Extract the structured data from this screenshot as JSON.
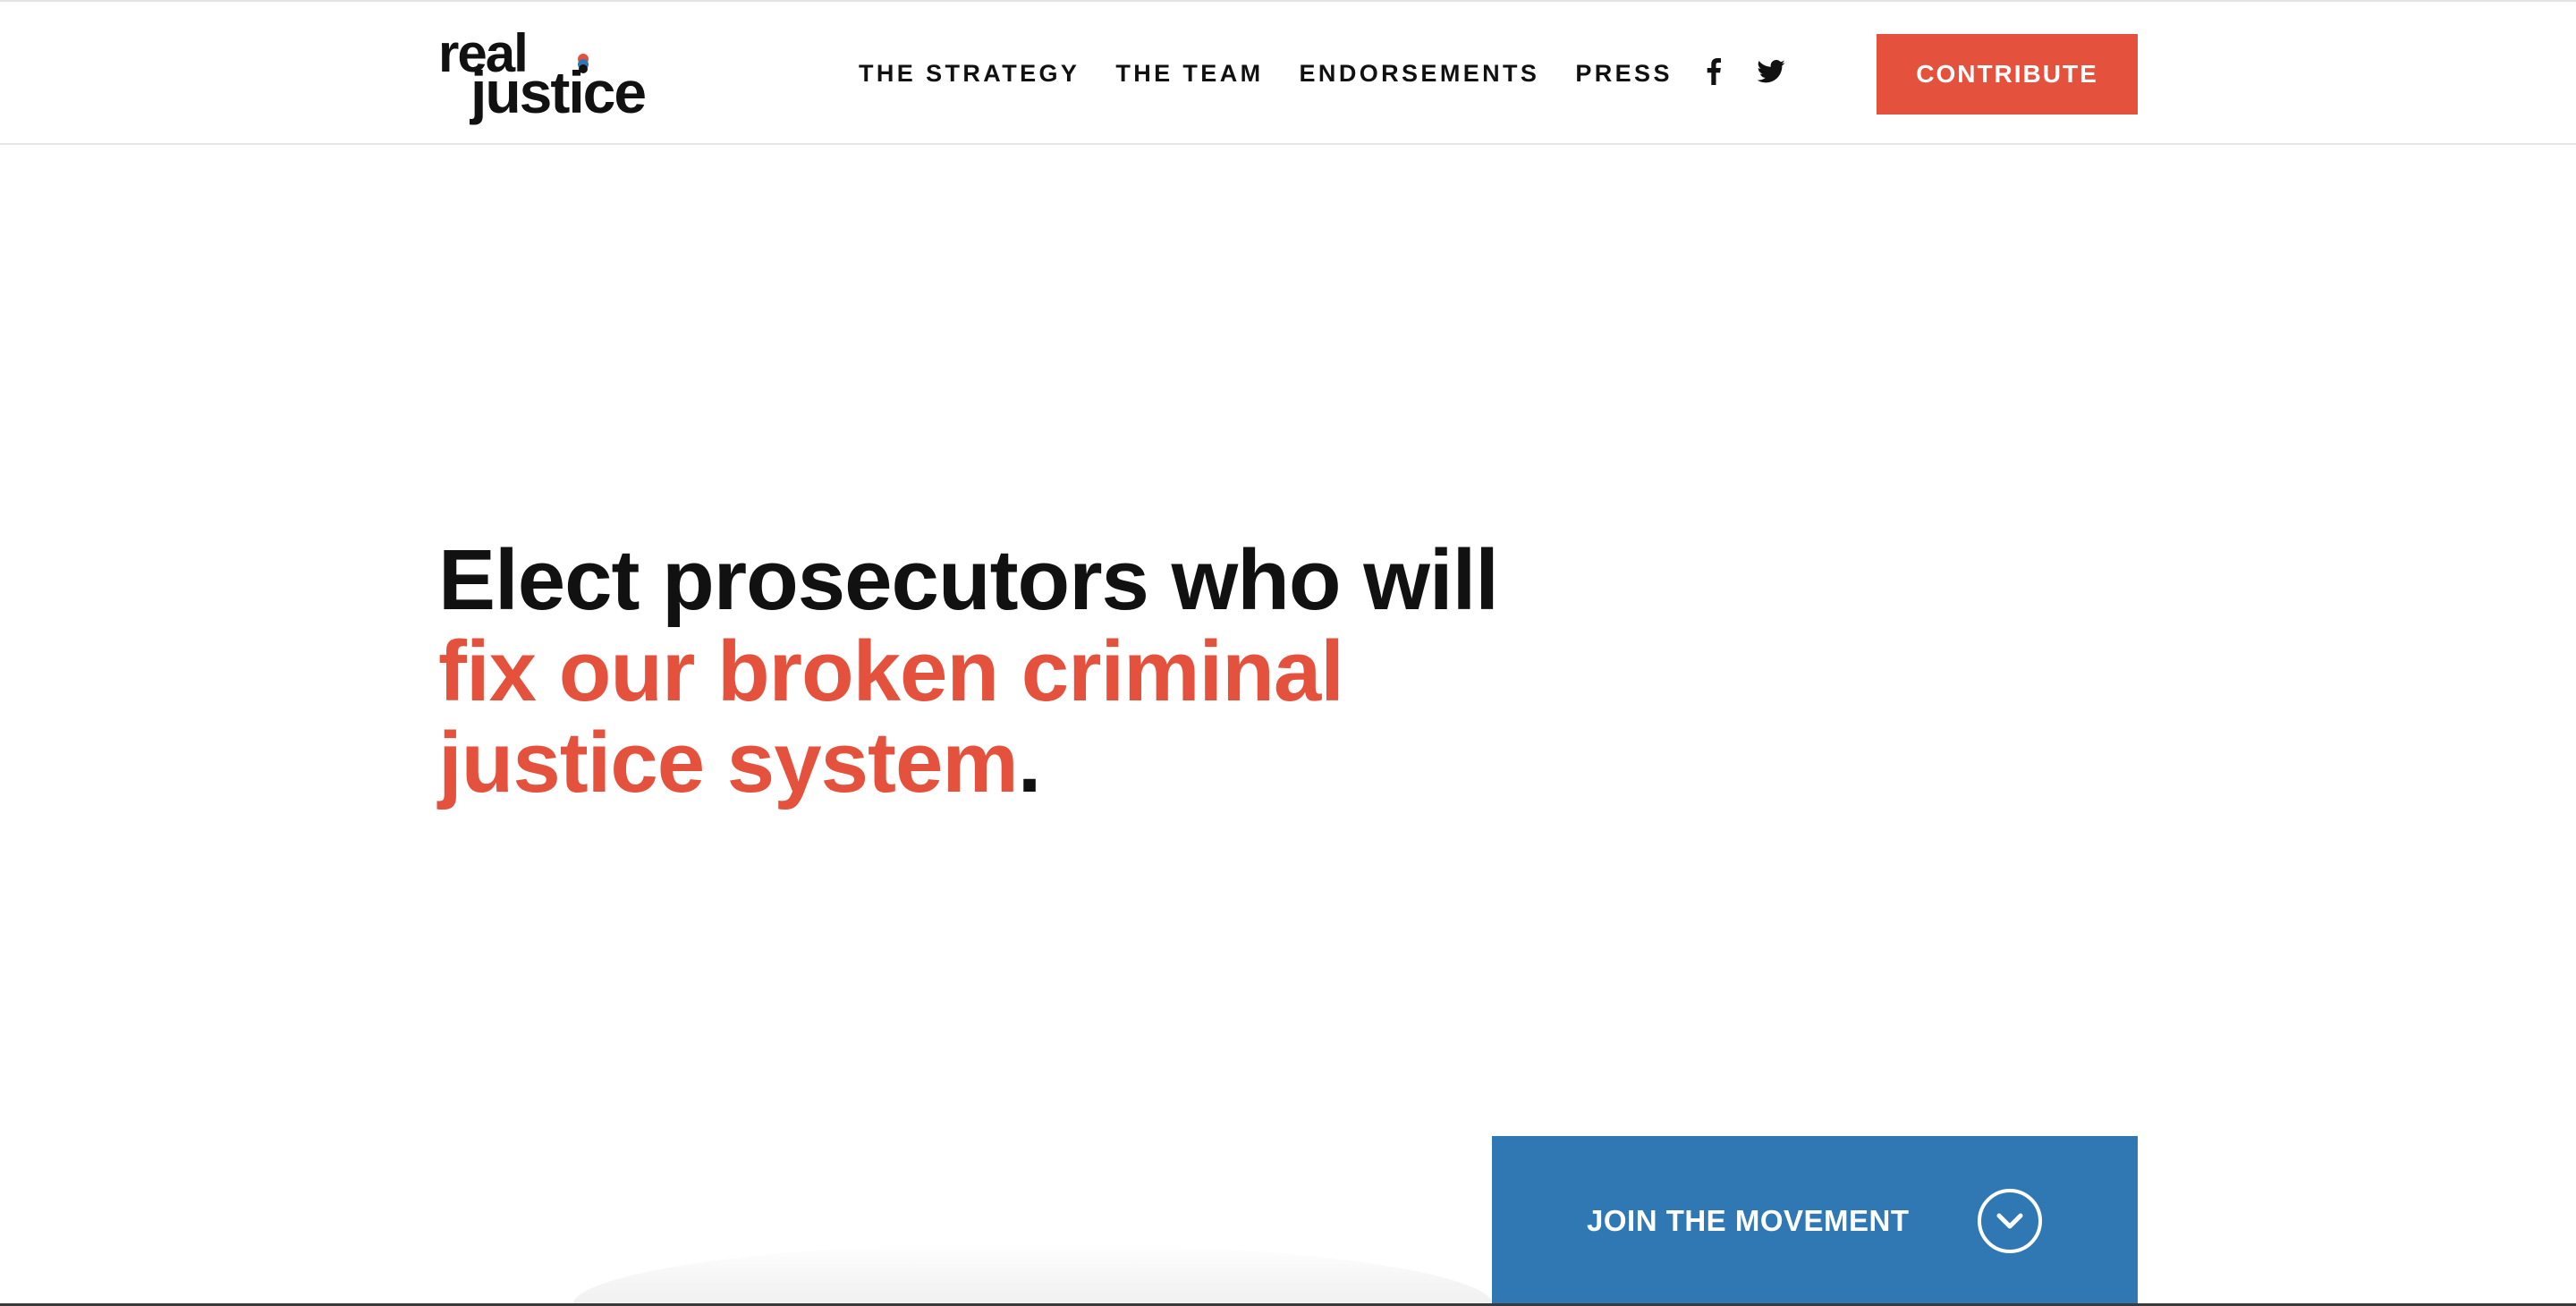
{
  "logo": {
    "line1": "real",
    "line2": "justice",
    "dot_colors": [
      "#e4513d",
      "#2f78b4",
      "#111111"
    ]
  },
  "nav": {
    "items": [
      {
        "label": "THE STRATEGY"
      },
      {
        "label": "THE TEAM"
      },
      {
        "label": "ENDORSEMENTS"
      },
      {
        "label": "PRESS"
      }
    ],
    "social": [
      {
        "icon": "facebook-icon"
      },
      {
        "icon": "twitter-icon"
      }
    ]
  },
  "contribute_label": "CONTRIBUTE",
  "hero": {
    "part1": "Elect prosecutors who will ",
    "accent": "fix our broken criminal justice system",
    "end": "."
  },
  "join": {
    "label": "JOIN THE MOVEMENT",
    "icon": "chevron-down-circle-icon"
  },
  "colors": {
    "accent_red": "#e4513d",
    "accent_blue": "#2f78b4",
    "text": "#111111"
  }
}
